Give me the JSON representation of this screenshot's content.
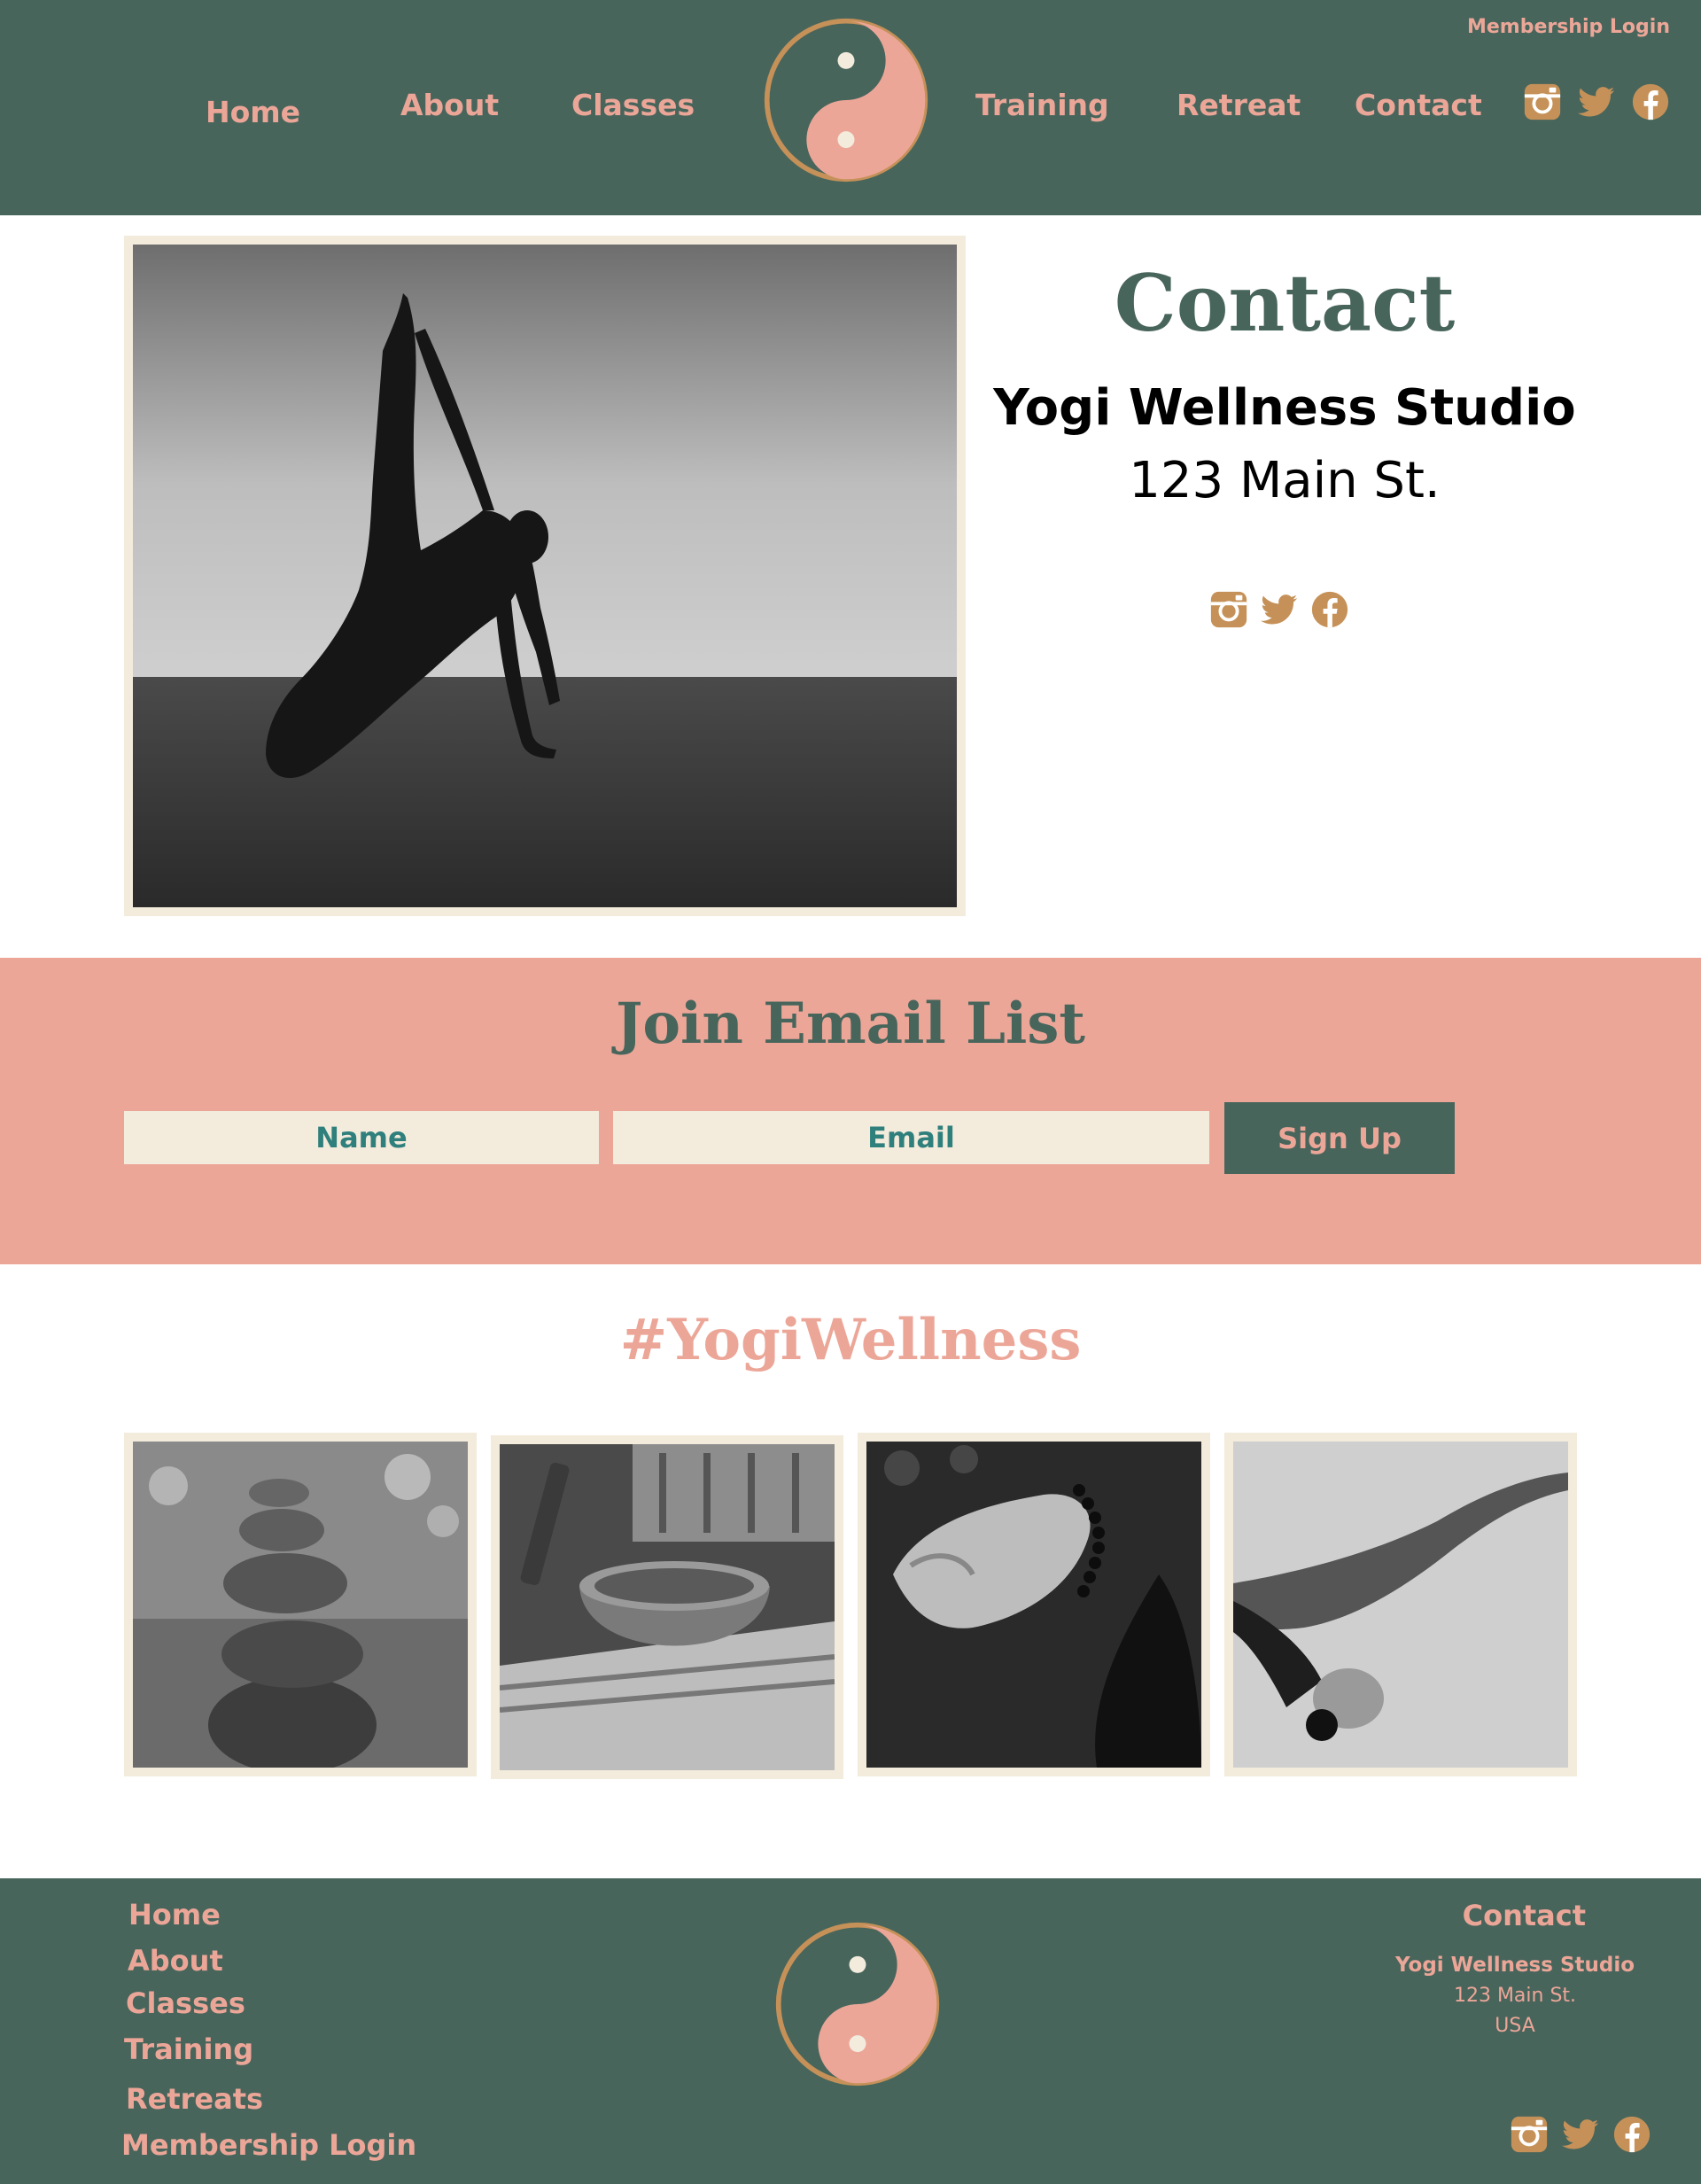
{
  "colors": {
    "primary": "#48655c",
    "accent": "#eca698",
    "cream": "#f3ebdc",
    "icon_gold": "#c59158",
    "field_text": "#2f7f7c"
  },
  "header": {
    "membership_login": "Membership Login",
    "nav": {
      "home": "Home",
      "about": "About",
      "classes": "Classes",
      "training": "Training",
      "retreat": "Retreat",
      "contact": "Contact"
    },
    "logo_icon": "yin-yang-icon",
    "social_icons": [
      "instagram-icon",
      "twitter-icon",
      "facebook-icon"
    ]
  },
  "contact": {
    "heading": "Contact",
    "studio_name": "Yogi Wellness Studio",
    "address": "123 Main St.",
    "photo": "black-and-white photo of woman in side plank yoga pose",
    "social_icons": [
      "instagram-icon",
      "twitter-icon",
      "facebook-icon"
    ]
  },
  "email_list": {
    "heading": "Join Email List",
    "name_placeholder": "Name",
    "email_placeholder": "Email",
    "signup_label": "Sign Up"
  },
  "gallery": {
    "hashtag": "#YogiWellness",
    "images": [
      "stacked zen stones",
      "singing bowl with mallet",
      "meditation hand with mala beads",
      "woman stretching in yoga pose"
    ]
  },
  "footer": {
    "links": {
      "home": "Home",
      "about": "About",
      "classes": "Classes",
      "training": "Training",
      "retreats": "Retreats",
      "membership_login": "Membership Login"
    },
    "contact_title": "Contact",
    "studio_name": "Yogi Wellness Studio",
    "address": "123 Main St.",
    "country": "USA",
    "social_icons": [
      "instagram-icon",
      "twitter-icon",
      "facebook-icon"
    ]
  }
}
